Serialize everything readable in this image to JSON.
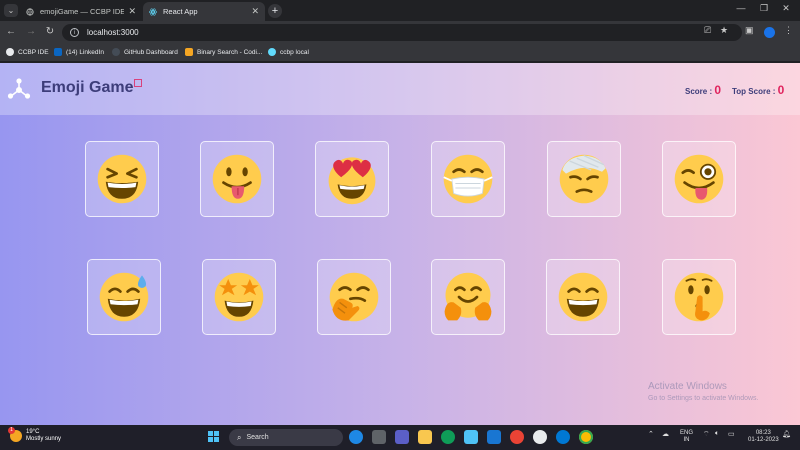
{
  "browser": {
    "tabs": [
      {
        "title": "emojiGame — CCBP IDE",
        "active": false
      },
      {
        "title": "React App",
        "active": true
      }
    ],
    "address": "localhost:3000",
    "bookmarks": [
      {
        "label": "CCBP IDE",
        "color": "#e8eaed"
      },
      {
        "label": "(14) LinkedIn",
        "color": "#0a66c2"
      },
      {
        "label": "GitHub Dashboard",
        "color": "#8b949e"
      },
      {
        "label": "Binary Search - Codi...",
        "color": "#f5a623"
      },
      {
        "label": "ccbp local",
        "color": "#61dafb"
      }
    ]
  },
  "app": {
    "title": "Emoji Game",
    "score_label": "Score :",
    "score": "0",
    "top_score_label": "Top Score :",
    "top_score": "0",
    "emojis": [
      {
        "name": "laughing-face",
        "row": 0
      },
      {
        "name": "face-with-tongue",
        "row": 0
      },
      {
        "name": "heart-eyes-face",
        "row": 0
      },
      {
        "name": "face-with-medical-mask",
        "row": 0
      },
      {
        "name": "face-with-head-bandage",
        "row": 0
      },
      {
        "name": "winking-face-with-tongue",
        "row": 0
      },
      {
        "name": "grinning-face-with-sweat",
        "row": 1
      },
      {
        "name": "star-struck-face",
        "row": 1
      },
      {
        "name": "face-with-hand-over-mouth",
        "row": 1
      },
      {
        "name": "hugging-face",
        "row": 1
      },
      {
        "name": "beaming-face",
        "row": 1
      },
      {
        "name": "shushing-face",
        "row": 1
      }
    ]
  },
  "watermark": {
    "title": "Activate Windows",
    "subtitle": "Go to Settings to activate Windows."
  },
  "taskbar": {
    "weather_temp": "19°C",
    "weather_desc": "Mostly sunny",
    "weather_badge": "1",
    "search_placeholder": "Search",
    "language": "ENG",
    "region": "IN",
    "time": "08:23",
    "date": "01-12-2023"
  }
}
